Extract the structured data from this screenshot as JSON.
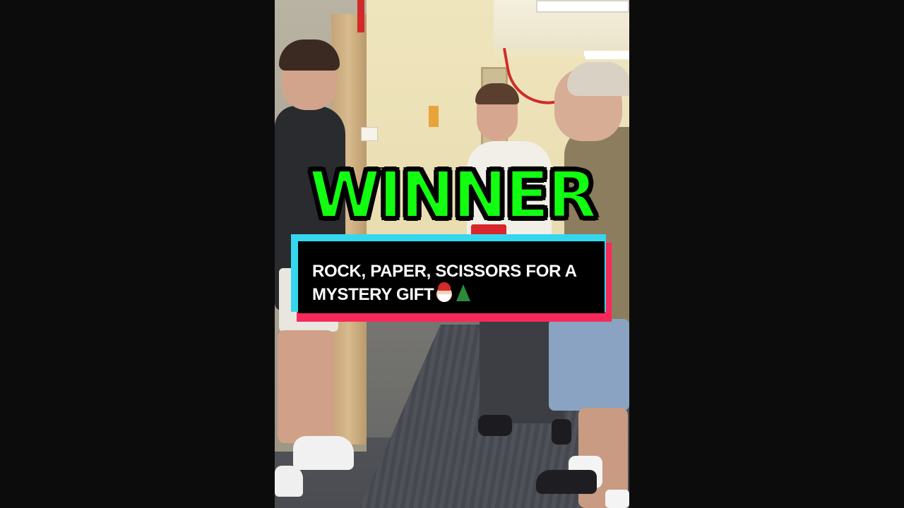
{
  "overlay": {
    "headline": "WINNER",
    "caption_line1": "ROCK, PAPER, SCISSORS FOR A",
    "caption_line2": "MYSTERY GIFT",
    "caption_emojis": [
      "santa-emoji",
      "christmas-tree-emoji"
    ]
  },
  "colors": {
    "headline": "#12ff12",
    "caption_box": "#000000",
    "caption_border_cyan": "#35d7ee",
    "caption_border_red": "#f8295a",
    "letterbox": "#0c0c0c"
  }
}
